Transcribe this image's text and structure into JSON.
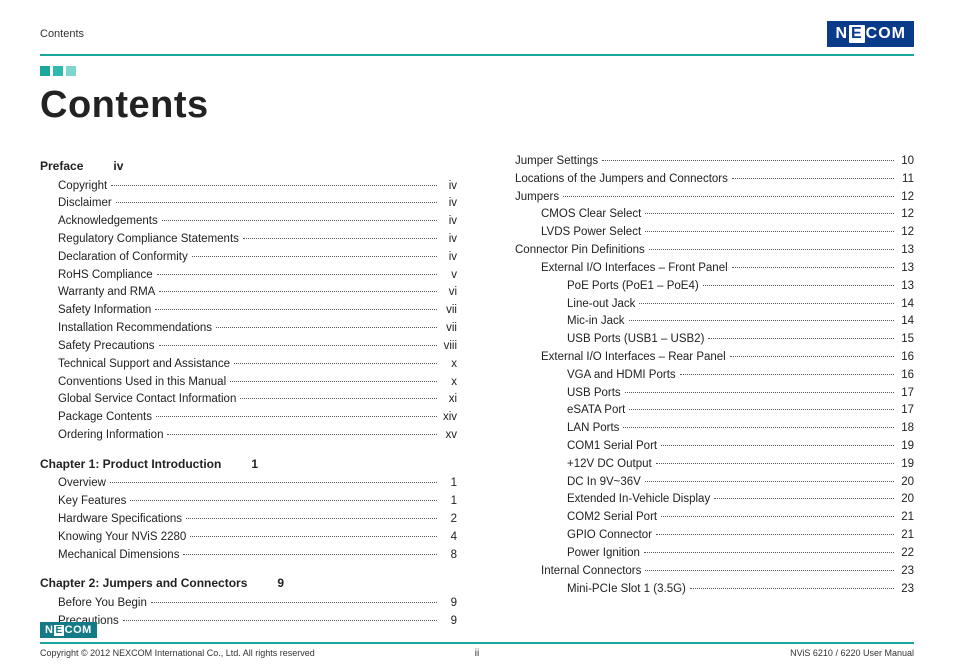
{
  "header": {
    "section_label": "Contents",
    "logo_text_1": "N",
    "logo_text_2": "E",
    "logo_text_3": "COM"
  },
  "squares": [
    "#1aa89c",
    "#2fb8ad",
    "#7fd5cf"
  ],
  "title": "Contents",
  "left_sections": [
    {
      "heading": "Preface",
      "page": "iv",
      "items": [
        {
          "t": "Copyright",
          "p": "iv",
          "i": 1
        },
        {
          "t": "Disclaimer",
          "p": "iv",
          "i": 1
        },
        {
          "t": "Acknowledgements",
          "p": "iv",
          "i": 1
        },
        {
          "t": "Regulatory Compliance Statements",
          "p": "iv",
          "i": 1
        },
        {
          "t": "Declaration of Conformity",
          "p": "iv",
          "i": 1
        },
        {
          "t": "RoHS Compliance",
          "p": "v",
          "i": 1
        },
        {
          "t": "Warranty and RMA",
          "p": "vi",
          "i": 1
        },
        {
          "t": "Safety Information",
          "p": "vii",
          "i": 1
        },
        {
          "t": "Installation Recommendations",
          "p": "vii",
          "i": 1
        },
        {
          "t": "Safety Precautions",
          "p": "viii",
          "i": 1
        },
        {
          "t": "Technical Support and Assistance",
          "p": "x",
          "i": 1
        },
        {
          "t": "Conventions Used in this Manual",
          "p": "x",
          "i": 1
        },
        {
          "t": "Global Service Contact Information",
          "p": "xi",
          "i": 1
        },
        {
          "t": "Package Contents",
          "p": "xiv",
          "i": 1
        },
        {
          "t": "Ordering Information",
          "p": "xv",
          "i": 1
        }
      ]
    },
    {
      "heading": "Chapter 1: Product Introduction",
      "page": "1",
      "items": [
        {
          "t": "Overview",
          "p": "1",
          "i": 1
        },
        {
          "t": "Key Features",
          "p": "1",
          "i": 1
        },
        {
          "t": "Hardware Specifications",
          "p": "2",
          "i": 1
        },
        {
          "t": "Knowing Your NViS 2280",
          "p": "4",
          "i": 1
        },
        {
          "t": "Mechanical Dimensions",
          "p": "8",
          "i": 1
        }
      ]
    },
    {
      "heading": "Chapter 2: Jumpers and Connectors",
      "page": "9",
      "items": [
        {
          "t": "Before You Begin",
          "p": "9",
          "i": 1
        },
        {
          "t": "Precautions",
          "p": "9",
          "i": 1
        }
      ]
    }
  ],
  "right_items": [
    {
      "t": "Jumper Settings",
      "p": "10",
      "i": 1
    },
    {
      "t": "Locations of the Jumpers and Connectors",
      "p": "11",
      "i": 1
    },
    {
      "t": "Jumpers",
      "p": "12",
      "i": 1
    },
    {
      "t": "CMOS Clear Select",
      "p": "12",
      "i": 2
    },
    {
      "t": "LVDS Power Select",
      "p": "12",
      "i": 2
    },
    {
      "t": "Connector Pin Definitions",
      "p": "13",
      "i": 1
    },
    {
      "t": "External I/O Interfaces – Front Panel",
      "p": "13",
      "i": 2
    },
    {
      "t": "PoE Ports (PoE1 – PoE4)",
      "p": "13",
      "i": 3
    },
    {
      "t": "Line-out Jack",
      "p": "14",
      "i": 3
    },
    {
      "t": "Mic-in Jack",
      "p": "14",
      "i": 3
    },
    {
      "t": "USB Ports (USB1 – USB2)",
      "p": "15",
      "i": 3
    },
    {
      "t": "External I/O Interfaces – Rear Panel",
      "p": "16",
      "i": 2
    },
    {
      "t": "VGA and HDMI Ports",
      "p": "16",
      "i": 3
    },
    {
      "t": "USB Ports",
      "p": "17",
      "i": 3
    },
    {
      "t": "eSATA Port",
      "p": "17",
      "i": 3
    },
    {
      "t": "LAN Ports",
      "p": "18",
      "i": 3
    },
    {
      "t": "COM1 Serial Port",
      "p": "19",
      "i": 3
    },
    {
      "t": "+12V DC Output",
      "p": "19",
      "i": 3
    },
    {
      "t": "DC In 9V~36V",
      "p": "20",
      "i": 3
    },
    {
      "t": "Extended In-Vehicle Display",
      "p": "20",
      "i": 3
    },
    {
      "t": "COM2 Serial Port",
      "p": "21",
      "i": 3
    },
    {
      "t": "GPIO Connector",
      "p": "21",
      "i": 3
    },
    {
      "t": "Power Ignition",
      "p": "22",
      "i": 3
    },
    {
      "t": "Internal Connectors",
      "p": "23",
      "i": 2
    },
    {
      "t": "Mini-PCIe Slot 1 (3.5G)",
      "p": "23",
      "i": 3
    }
  ],
  "footer": {
    "copyright": "Copyright © 2012 NEXCOM International Co., Ltd. All rights reserved",
    "page_num": "ii",
    "right": "NViS 6210 / 6220 User Manual",
    "logo_text_1": "N",
    "logo_text_2": "E",
    "logo_text_3": "COM"
  }
}
